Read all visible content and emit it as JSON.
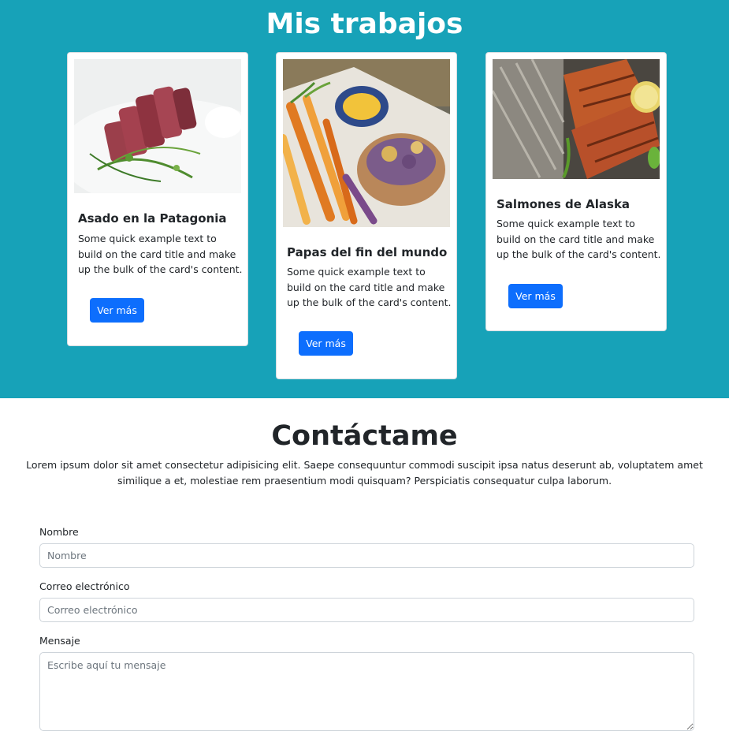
{
  "works": {
    "title": "Mis trabajos",
    "cards": [
      {
        "title": "Asado en la Patagonia",
        "text": "Some quick example text to build on the card title and make up the bulk of the card's content.",
        "button": "Ver más"
      },
      {
        "title": "Papas del fin del mundo",
        "text": "Some quick example text to build on the card title and make up the bulk of the card's content.",
        "button": "Ver más"
      },
      {
        "title": "Salmones de Alaska",
        "text": "Some quick example text to build on the card title and make up the bulk of the card's content.",
        "button": "Ver más"
      }
    ]
  },
  "contact": {
    "title": "Contáctame",
    "description": "Lorem ipsum dolor sit amet consectetur adipisicing elit. Saepe consequuntur commodi suscipit ipsa natus deserunt ab, voluptatem amet similique a et, molestiae rem praesentium modi quisquam? Perspiciatis consequatur culpa laborum.",
    "fields": {
      "name": {
        "label": "Nombre",
        "placeholder": "Nombre"
      },
      "email": {
        "label": "Correo electrónico",
        "placeholder": "Correo electrónico"
      },
      "message": {
        "label": "Mensaje",
        "placeholder": "Escribe aquí tu mensaje"
      }
    }
  },
  "colors": {
    "accent": "#17a2b8",
    "button": "#0d6efd"
  }
}
